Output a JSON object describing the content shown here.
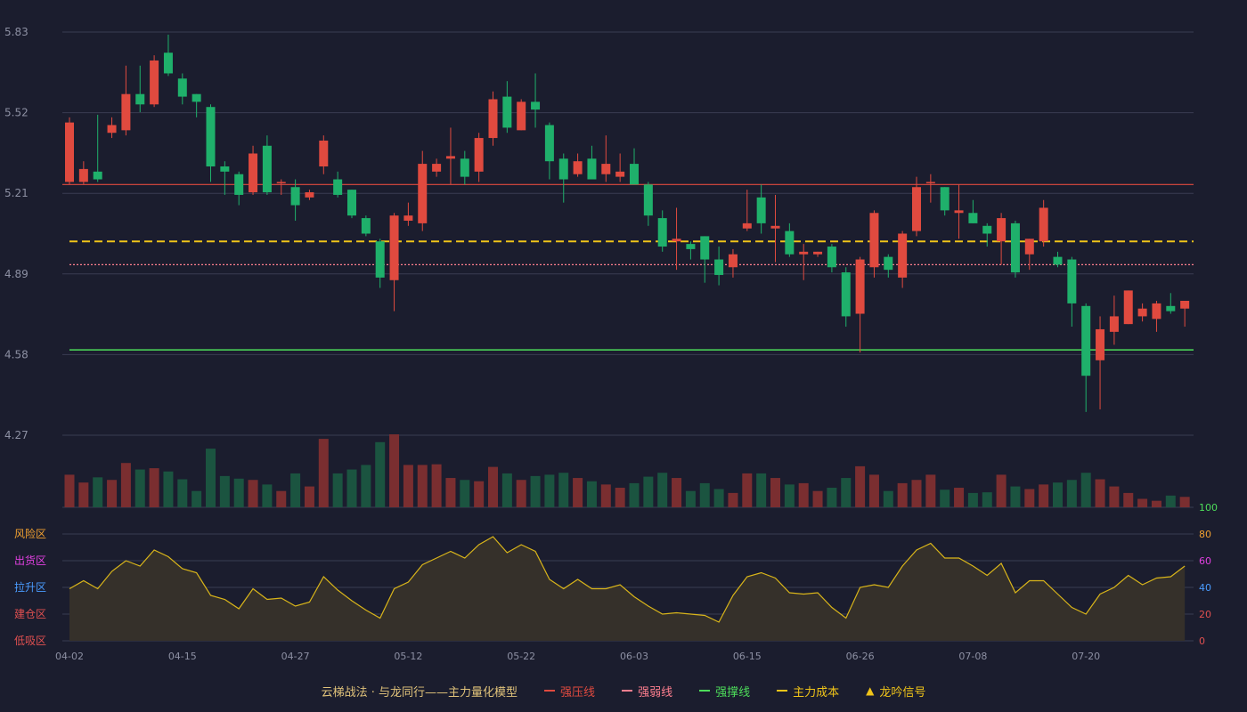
{
  "colors": {
    "background": "#1b1d2e",
    "grid": "#3a3d52",
    "axis_text": "#8d90a3",
    "up": "#e04a3f",
    "down": "#1fb06b",
    "vol_up": "#7a2e30",
    "vol_down": "#1b5440",
    "resistance": "#e04a3f",
    "weak": "#ff7f8f",
    "support": "#4ddc5a",
    "cost": "#f0c419",
    "oscillator_line": "#d9b51a",
    "oscillator_fill": "#35302a"
  },
  "legend": {
    "title": "云梯战法 · 与龙同行——主力量化模型",
    "resistance": "强压线",
    "weak": "强弱线",
    "support": "强撑线",
    "cost": "主力成本",
    "signal": "龙吟信号"
  },
  "chart_data": [
    {
      "type": "candlestick",
      "title": "",
      "ylim": [
        4.27,
        5.83
      ],
      "y_ticks": [
        "5.83",
        "5.52",
        "5.21",
        "4.89",
        "4.58",
        "4.27"
      ],
      "x_ticks": [
        "04-02",
        "04-15",
        "04-27",
        "05-12",
        "05-22",
        "06-03",
        "06-15",
        "06-26",
        "07-08",
        "07-20"
      ],
      "x_tick_index": [
        0,
        8,
        16,
        24,
        32,
        40,
        48,
        56,
        64,
        72
      ],
      "lines": {
        "resistance": 5.24,
        "cost": 5.02,
        "weak": 4.93,
        "support": 4.6
      },
      "candles": [
        [
          5.25,
          5.48,
          5.5,
          5.24
        ],
        [
          5.25,
          5.3,
          5.33,
          5.24
        ],
        [
          5.29,
          5.26,
          5.51,
          5.25
        ],
        [
          5.44,
          5.47,
          5.5,
          5.42
        ],
        [
          5.45,
          5.59,
          5.7,
          5.43
        ],
        [
          5.59,
          5.55,
          5.7,
          5.52
        ],
        [
          5.55,
          5.72,
          5.74,
          5.54
        ],
        [
          5.75,
          5.67,
          5.82,
          5.66
        ],
        [
          5.65,
          5.58,
          5.67,
          5.55
        ],
        [
          5.59,
          5.56,
          5.59,
          5.5
        ],
        [
          5.54,
          5.31,
          5.55,
          5.25
        ],
        [
          5.31,
          5.29,
          5.33,
          5.2
        ],
        [
          5.28,
          5.2,
          5.29,
          5.16
        ],
        [
          5.21,
          5.36,
          5.39,
          5.2
        ],
        [
          5.39,
          5.21,
          5.43,
          5.2
        ],
        [
          5.25,
          5.25,
          5.26,
          5.2
        ],
        [
          5.23,
          5.16,
          5.26,
          5.1
        ],
        [
          5.19,
          5.21,
          5.22,
          5.18
        ],
        [
          5.31,
          5.41,
          5.43,
          5.28
        ],
        [
          5.26,
          5.2,
          5.29,
          5.19
        ],
        [
          5.22,
          5.12,
          5.22,
          5.11
        ],
        [
          5.11,
          5.05,
          5.12,
          5.04
        ],
        [
          5.02,
          4.88,
          5.03,
          4.84
        ],
        [
          4.87,
          5.12,
          5.13,
          4.75
        ],
        [
          5.1,
          5.12,
          5.17,
          5.08
        ],
        [
          5.09,
          5.32,
          5.37,
          5.06
        ],
        [
          5.29,
          5.32,
          5.34,
          5.27
        ],
        [
          5.34,
          5.35,
          5.46,
          5.24
        ],
        [
          5.34,
          5.27,
          5.37,
          5.24
        ],
        [
          5.29,
          5.42,
          5.44,
          5.25
        ],
        [
          5.42,
          5.57,
          5.6,
          5.39
        ],
        [
          5.58,
          5.46,
          5.64,
          5.44
        ],
        [
          5.45,
          5.56,
          5.57,
          5.45
        ],
        [
          5.56,
          5.53,
          5.67,
          5.46
        ],
        [
          5.47,
          5.33,
          5.48,
          5.26
        ],
        [
          5.34,
          5.26,
          5.36,
          5.17
        ],
        [
          5.28,
          5.33,
          5.36,
          5.27
        ],
        [
          5.34,
          5.26,
          5.39,
          5.27
        ],
        [
          5.28,
          5.32,
          5.43,
          5.25
        ],
        [
          5.27,
          5.29,
          5.36,
          5.25
        ],
        [
          5.32,
          5.24,
          5.38,
          5.25
        ],
        [
          5.24,
          5.12,
          5.25,
          5.08
        ],
        [
          5.11,
          5.0,
          5.14,
          4.98
        ],
        [
          5.02,
          5.03,
          5.15,
          4.91
        ],
        [
          5.01,
          4.99,
          5.02,
          4.95
        ],
        [
          5.04,
          4.95,
          5.04,
          4.86
        ],
        [
          4.95,
          4.89,
          5.0,
          4.85
        ],
        [
          4.92,
          4.97,
          4.99,
          4.88
        ],
        [
          5.07,
          5.09,
          5.22,
          5.06
        ],
        [
          5.19,
          5.09,
          5.24,
          5.05
        ],
        [
          5.07,
          5.08,
          5.2,
          4.94
        ],
        [
          5.06,
          4.97,
          5.09,
          4.96
        ],
        [
          4.97,
          4.98,
          5.01,
          4.87
        ],
        [
          4.97,
          4.98,
          4.98,
          4.96
        ],
        [
          5.0,
          4.92,
          5.01,
          4.9
        ],
        [
          4.9,
          4.73,
          4.92,
          4.69
        ],
        [
          4.74,
          4.95,
          4.96,
          4.59
        ],
        [
          4.92,
          5.13,
          5.14,
          4.88
        ],
        [
          4.96,
          4.91,
          4.97,
          4.88
        ],
        [
          4.88,
          5.05,
          5.06,
          4.84
        ],
        [
          5.06,
          5.23,
          5.27,
          5.04
        ],
        [
          5.25,
          5.25,
          5.28,
          5.17
        ],
        [
          5.23,
          5.14,
          5.23,
          5.12
        ],
        [
          5.13,
          5.14,
          5.24,
          5.03
        ],
        [
          5.13,
          5.09,
          5.18,
          5.09
        ],
        [
          5.08,
          5.05,
          5.09,
          5.0
        ],
        [
          5.02,
          5.11,
          5.13,
          4.93
        ],
        [
          5.09,
          4.9,
          5.1,
          4.88
        ],
        [
          4.97,
          5.03,
          5.03,
          4.91
        ],
        [
          5.02,
          5.15,
          5.18,
          5.0
        ],
        [
          4.96,
          4.93,
          4.98,
          4.92
        ],
        [
          4.95,
          4.78,
          4.96,
          4.69
        ],
        [
          4.77,
          4.5,
          4.78,
          4.36
        ],
        [
          4.56,
          4.68,
          4.73,
          4.37
        ],
        [
          4.67,
          4.73,
          4.81,
          4.62
        ],
        [
          4.7,
          4.83,
          4.83,
          4.7
        ],
        [
          4.73,
          4.76,
          4.78,
          4.71
        ],
        [
          4.72,
          4.78,
          4.79,
          4.67
        ],
        [
          4.77,
          4.75,
          4.82,
          4.74
        ],
        [
          4.76,
          4.79,
          4.78,
          4.69
        ]
      ],
      "volume": [
        50,
        38,
        46,
        42,
        68,
        58,
        60,
        55,
        43,
        25,
        90,
        48,
        44,
        42,
        35,
        25,
        52,
        32,
        105,
        52,
        58,
        65,
        100,
        112,
        65,
        65,
        66,
        45,
        42,
        40,
        62,
        52,
        42,
        48,
        50,
        53,
        45,
        40,
        35,
        30,
        37,
        47,
        53,
        45,
        25,
        37,
        28,
        22,
        52,
        52,
        45,
        35,
        37,
        25,
        30,
        45,
        63,
        50,
        25,
        37,
        42,
        50,
        27,
        30,
        22,
        23,
        50,
        32,
        28,
        35,
        38,
        42,
        53,
        43,
        32,
        22,
        13,
        10,
        18,
        16
      ]
    },
    {
      "type": "area",
      "title": "",
      "ylim": [
        0,
        100
      ],
      "y_ticks": [
        "100",
        "80",
        "60",
        "40",
        "20",
        "0"
      ],
      "zones": [
        "风险区",
        "出货区",
        "拉升区",
        "建仓区",
        "低吸区"
      ],
      "values": [
        39,
        45,
        39,
        52,
        60,
        56,
        68,
        63,
        54,
        51,
        34,
        31,
        24,
        39,
        31,
        32,
        26,
        29,
        48,
        38,
        30,
        23,
        17,
        39,
        44,
        57,
        62,
        67,
        62,
        72,
        78,
        66,
        72,
        67,
        46,
        39,
        46,
        39,
        39,
        42,
        33,
        26,
        20,
        21,
        20,
        19,
        14,
        34,
        48,
        51,
        47,
        36,
        35,
        36,
        25,
        17,
        40,
        42,
        40,
        56,
        68,
        73,
        62,
        62,
        56,
        49,
        58,
        36,
        45,
        45,
        35,
        25,
        20,
        35,
        40,
        49,
        42,
        47,
        48,
        56
      ]
    }
  ]
}
